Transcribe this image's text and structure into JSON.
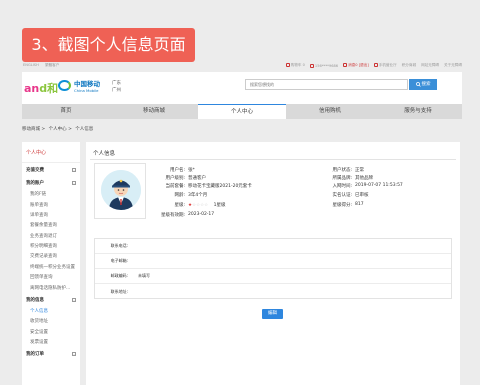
{
  "overlay_banner": "3、截图个人信息页面",
  "topbar": {
    "left_links": [
      "ENGLISH",
      "繁體客户"
    ],
    "right_items": [
      {
        "label": "购物车 0",
        "icon": "cart-icon"
      },
      {
        "label": "156****9686",
        "icon": "user-icon"
      },
      {
        "label": "消息0 [退出]",
        "icon": "mail-icon",
        "accent": true
      },
      {
        "label": "手机营业厅",
        "icon": "phone-icon"
      },
      {
        "label": "积分商城",
        "icon": ""
      },
      {
        "label": "网站无障碍",
        "icon": ""
      },
      {
        "label": "关于无障碍",
        "icon": ""
      }
    ]
  },
  "header": {
    "logo_andlu": {
      "part1": "an",
      "part2": "d和"
    },
    "logo_cm": {
      "cn": "中国移动",
      "en": "China Mobile"
    },
    "region": {
      "province": "广东",
      "city": "广州"
    },
    "search_placeholder": "搜索您想找的",
    "search_button": "搜索"
  },
  "nav": {
    "tabs": [
      "首页",
      "移动商城",
      "个人中心",
      "信用购机",
      "服务与支持"
    ],
    "active_index": 2
  },
  "breadcrumb": [
    "移动商城 >",
    "个人中心 >",
    "个人信息"
  ],
  "sidebar": {
    "title": "个人中心",
    "sections": [
      {
        "label": "充值交费",
        "items": []
      },
      {
        "label": "我的账户",
        "items": [
          "我的F链",
          "账单查询",
          "详单查询",
          "套餐余量查询",
          "业务查询退订",
          "积分明细查询",
          "交费记录查询",
          "终端统一积分业务设置",
          "回馈单查询",
          "离网电话隐私防护..."
        ]
      },
      {
        "label": "我的信息",
        "items": [
          "个人信息",
          "收货地址",
          "安全设置",
          "发票设置"
        ],
        "active_item": "个人信息"
      },
      {
        "label": "我的订单",
        "items": []
      }
    ]
  },
  "main": {
    "title": "个人信息",
    "left_fields": [
      {
        "label": "用户名:",
        "value": "张*"
      },
      {
        "label": "用户级别:",
        "value": "普通客户"
      },
      {
        "label": "当前套餐:",
        "value": "移动花卡宝藏版2021-20元套卡"
      },
      {
        "label": "网龄:",
        "value": "3年4个月"
      },
      {
        "label": "星级:",
        "value": "1星级"
      },
      {
        "label": "星级有效期:",
        "value": "2023-02-17"
      }
    ],
    "right_fields": [
      {
        "label": "用户状态:",
        "value": "正常"
      },
      {
        "label": "所属品牌:",
        "value": "其他品牌"
      },
      {
        "label": "入网时间:",
        "value": "2019-07-07 11:53:57"
      },
      {
        "label": "实名认证:",
        "value": "已审核"
      },
      {
        "label": "星级得分:",
        "value": "817"
      }
    ],
    "star_rating": {
      "filled": 1,
      "total": 5
    },
    "address_rows": [
      {
        "label": "联系电话:",
        "value": ""
      },
      {
        "label": "电子邮箱:",
        "value": ""
      },
      {
        "label": "邮政编码:",
        "value": "未填写"
      },
      {
        "label": "联系地址:",
        "value": ""
      }
    ],
    "edit_button": "编辑"
  },
  "colors": {
    "banner": "#ef6155",
    "accent_blue": "#2e86de",
    "accent_red": "#c33333"
  }
}
